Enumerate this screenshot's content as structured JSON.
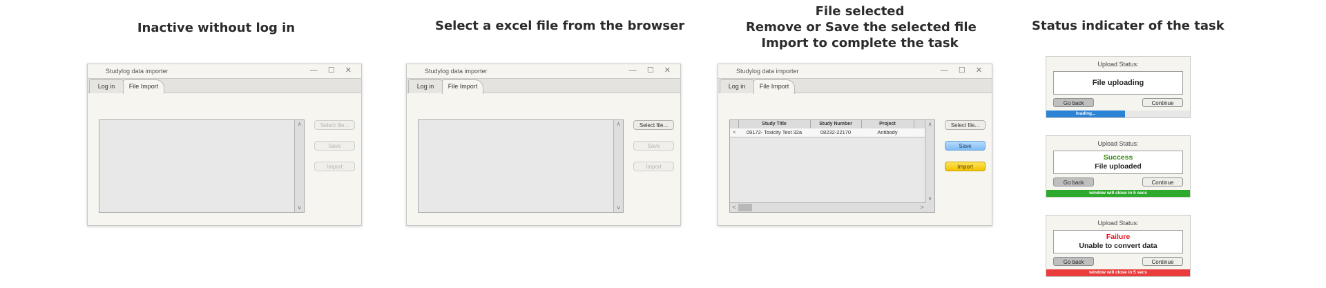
{
  "headings": {
    "inactive": [
      "Inactive without log in"
    ],
    "select": [
      "Select a excel file from the browser"
    ],
    "selected": [
      "File selected",
      "Remove or Save the selected file",
      "Import to complete the task"
    ],
    "status": [
      "Status indicater of the task"
    ]
  },
  "app": {
    "title": "Studylog data importer",
    "window_controls": "— ☐ ✕",
    "tabs": {
      "login": "Log in",
      "file_import": "File Import"
    },
    "buttons": {
      "select_file": "Select file...",
      "save": "Save",
      "import": "Import"
    },
    "scroll": {
      "up": "∧",
      "down": "∨",
      "left": "<",
      "right": ">"
    }
  },
  "table": {
    "columns": [
      "",
      "Study Title",
      "Study Number",
      "Project",
      ""
    ],
    "rows": [
      {
        "remove": "✕",
        "title": "09172- Toxicity Test 32a",
        "number": "08232-22170",
        "project": "Antibody"
      }
    ]
  },
  "status_panels": {
    "label": "Upload Status:",
    "uploading": {
      "text": "File uploading",
      "bar": "loading...",
      "progress": 0.55,
      "bar_color": "#2b83d6"
    },
    "success": {
      "line1": "Success",
      "line2": "File uploaded",
      "bar": "window will close in 5 secs",
      "line1_color": "#3a8a12",
      "bar_color": "#2daa2d"
    },
    "failure": {
      "line1": "Failure",
      "line2": "Unable to convert data",
      "bar": "window will close in 5 secs",
      "line1_color": "#e0101a",
      "bar_color": "#ea3c3c"
    },
    "buttons": {
      "back": "Go back",
      "continue": "Continue"
    }
  }
}
